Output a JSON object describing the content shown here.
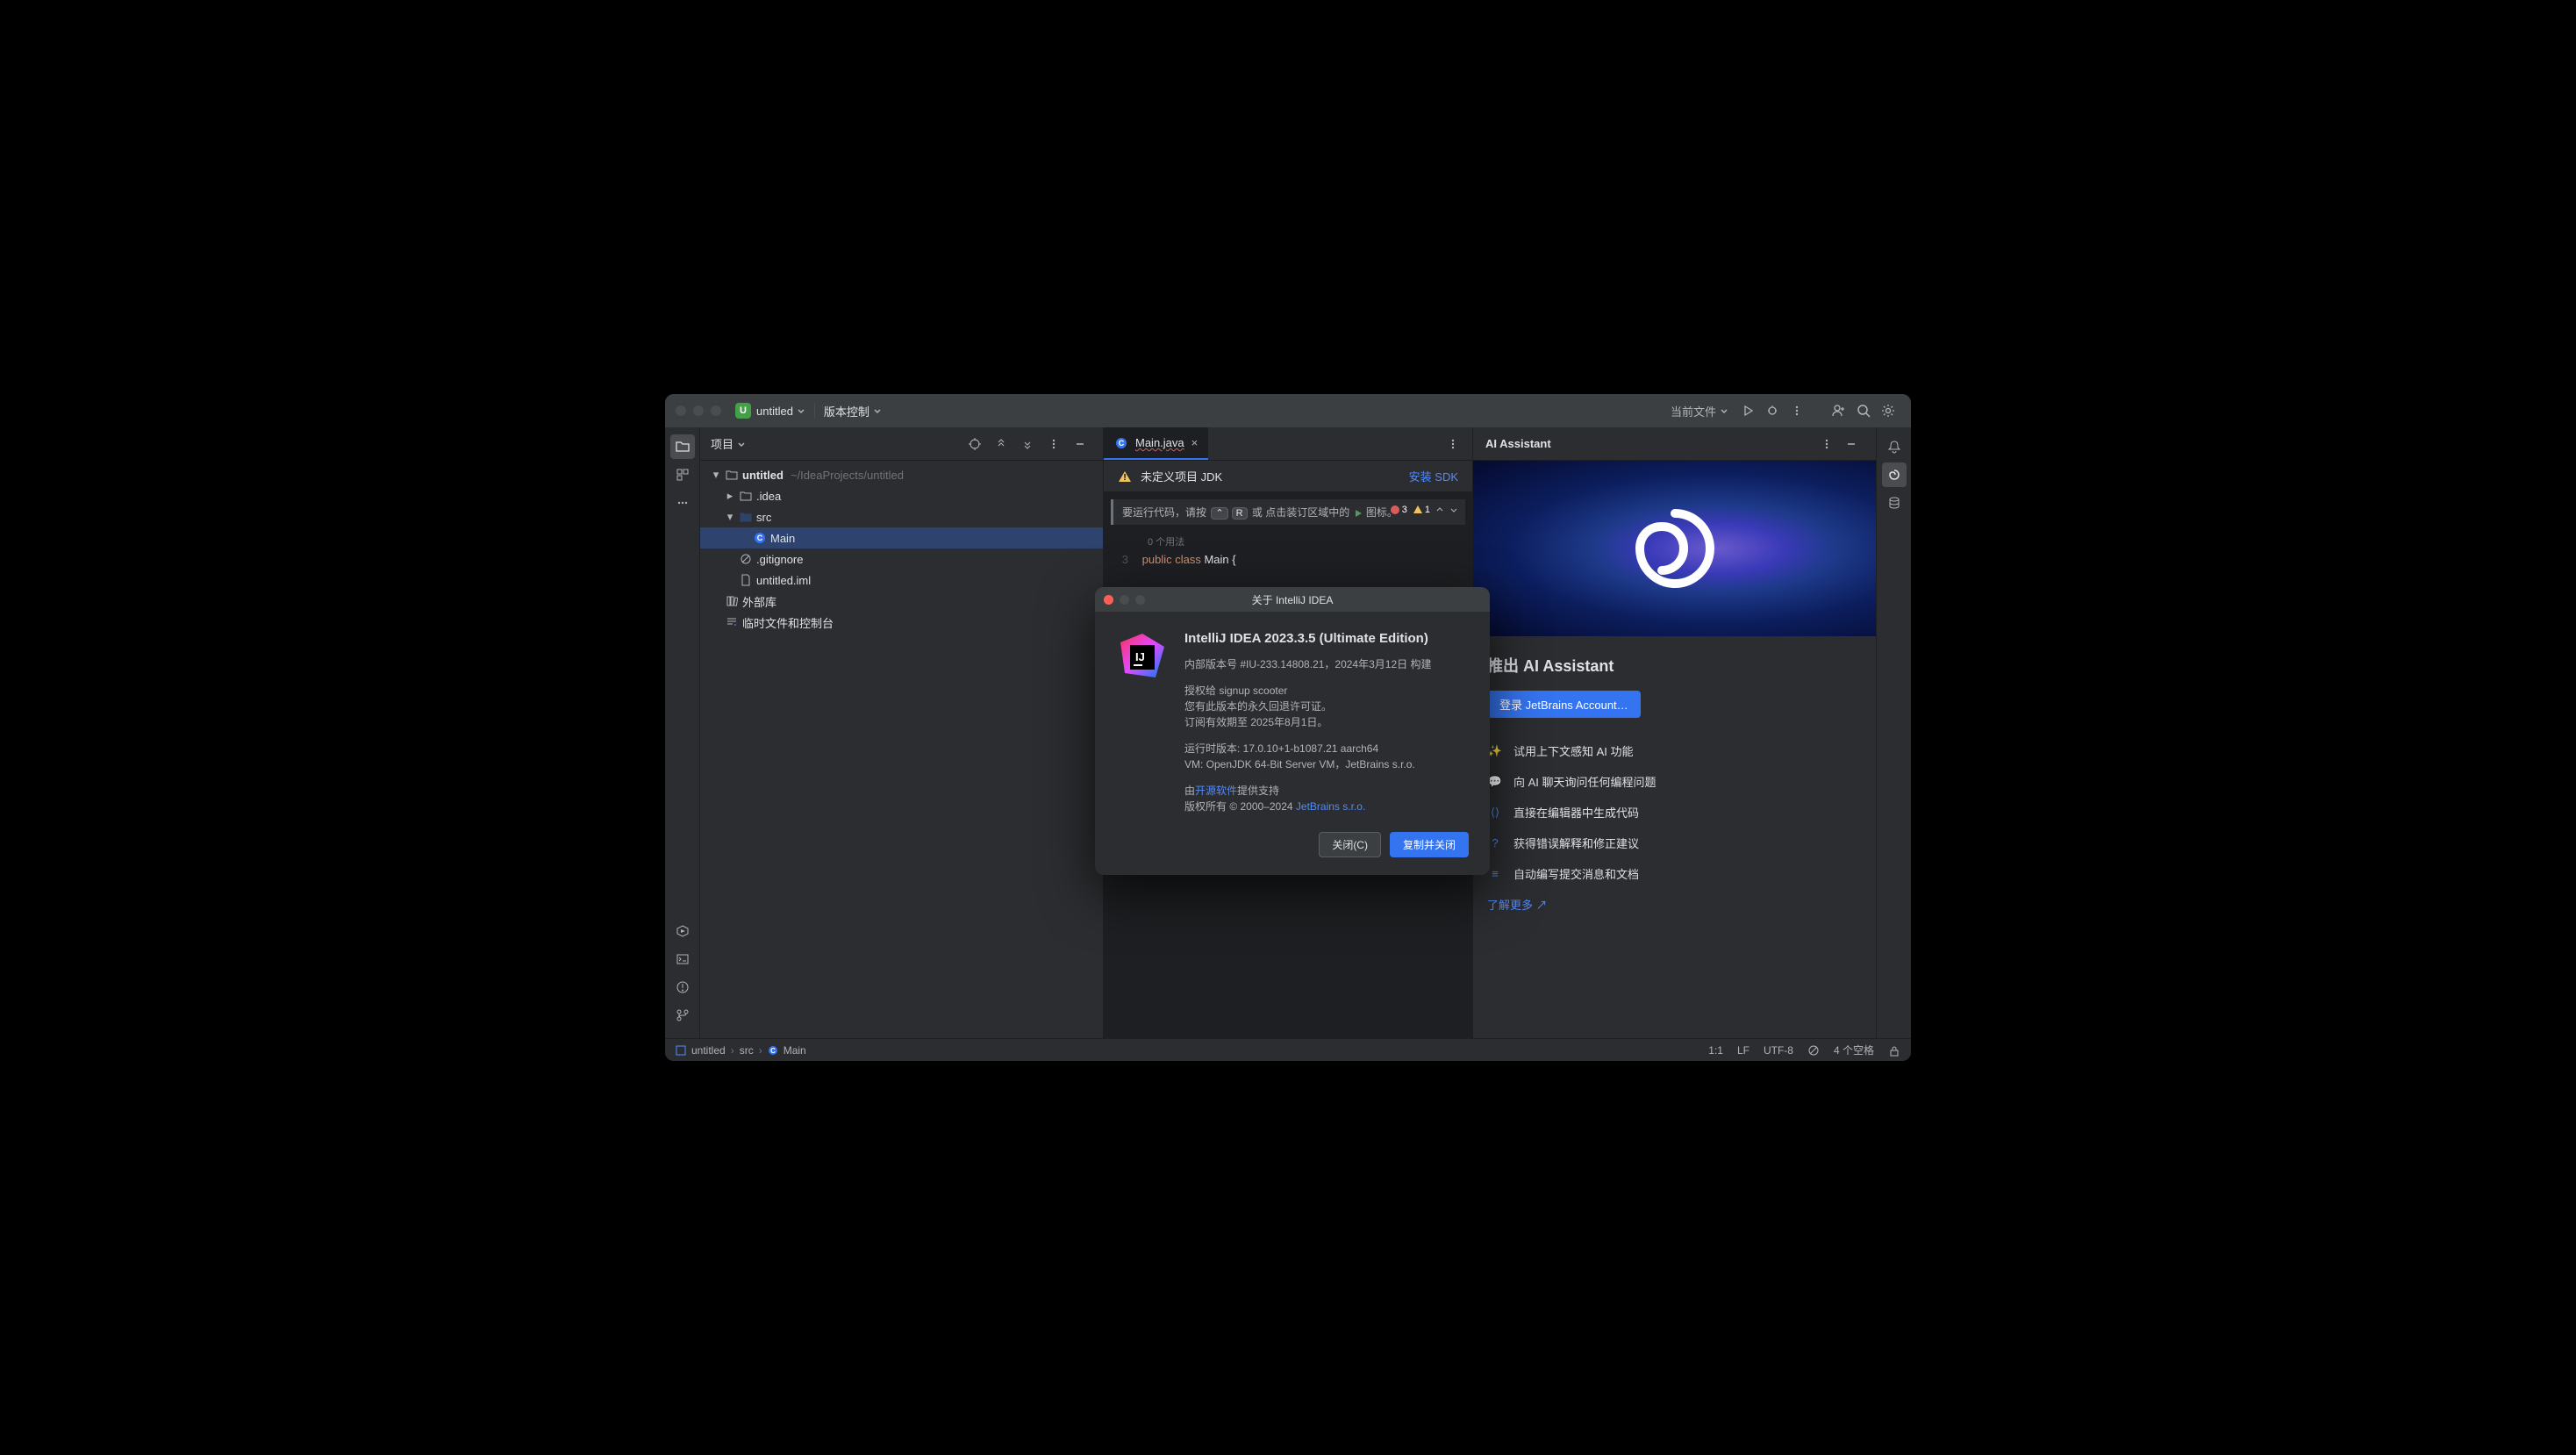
{
  "titlebar": {
    "project_letter": "U",
    "project_name": "untitled",
    "vcs_label": "版本控制",
    "current_file": "当前文件"
  },
  "project_panel": {
    "title": "项目",
    "root_name": "untitled",
    "root_path": "~/IdeaProjects/untitled",
    "items": {
      "idea": ".idea",
      "src": "src",
      "main": "Main",
      "gitignore": ".gitignore",
      "iml": "untitled.iml",
      "external": "外部库",
      "scratch": "临时文件和控制台"
    }
  },
  "editor": {
    "tab_name": "Main.java",
    "banner_text": "未定义项目 JDK",
    "banner_link": "安装 SDK",
    "hint_text": "要运行代码，请按",
    "hint_key1": "⌃",
    "hint_key2": "R",
    "hint_mid": "或 点击装订区域中的",
    "hint_end": "图标。",
    "err_count": "3",
    "warn_count": "1",
    "usage": "0 个用法",
    "line_num": "3",
    "code_kw1": "public",
    "code_kw2": "class",
    "code_cls": "Main",
    "code_pn": "{"
  },
  "ai": {
    "header": "AI Assistant",
    "title": "推出 AI Assistant",
    "login": "登录 JetBrains Account…",
    "features": [
      "试用上下文感知 AI 功能",
      "向 AI 聊天询问任何编程问题",
      "直接在编辑器中生成代码",
      "获得错误解释和修正建议",
      "自动编写提交消息和文档"
    ],
    "more": "了解更多 ↗"
  },
  "about": {
    "title": "关于 IntelliJ IDEA",
    "heading": "IntelliJ IDEA 2023.3.5 (Ultimate Edition)",
    "build": "内部版本号 #IU-233.14808.21，2024年3月12日 构建",
    "lic1": "授权给 signup scooter",
    "lic2": "您有此版本的永久回退许可证。",
    "lic3": "订阅有效期至 2025年8月1日。",
    "rt1": "运行时版本: 17.0.10+1-b1087.21 aarch64",
    "rt2": "VM: OpenJDK 64-Bit Server VM，JetBrains s.r.o.",
    "os_pre": "由",
    "os_link": "开源软件",
    "os_post": "提供支持",
    "cp_pre": "版权所有 © 2000–2024 ",
    "cp_link": "JetBrains s.r.o.",
    "btn_close": "关闭(C)",
    "btn_copy": "复制并关闭"
  },
  "footer": {
    "crumbs": [
      "untitled",
      "src",
      "Main"
    ],
    "pos": "1:1",
    "le": "LF",
    "enc": "UTF-8",
    "indent": "4 个空格"
  }
}
